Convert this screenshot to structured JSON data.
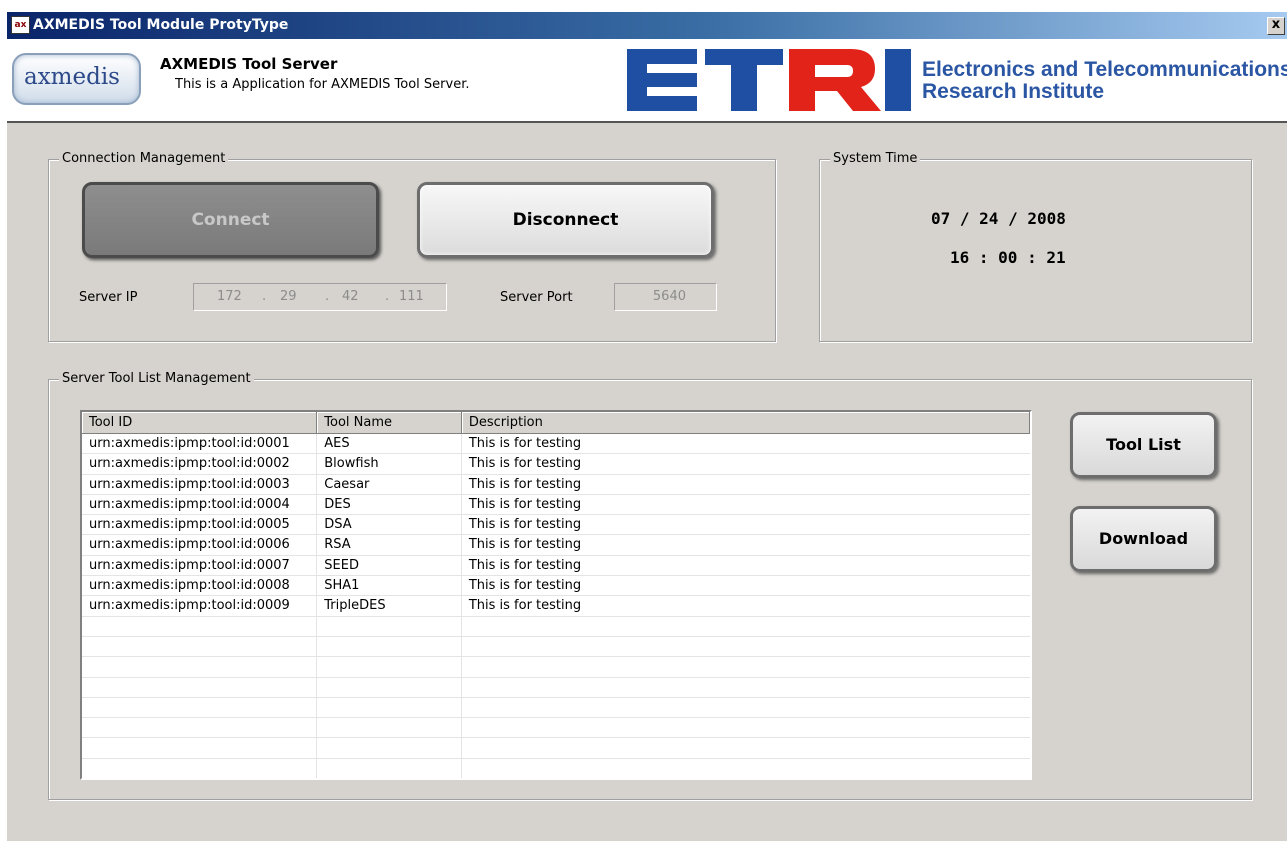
{
  "window": {
    "title": "AXMEDIS Tool Module ProtyType",
    "icon": "app-icon",
    "icon_text": "ax",
    "close_label": "x"
  },
  "banner": {
    "logo_text": "axmedis",
    "title": "AXMEDIS Tool Server",
    "subtitle": "This is a Application for AXMEDIS Tool Server.",
    "etri_logo_text": "ETRI",
    "org_line1": "Electronics and Telecommunications",
    "org_line2": "Research Institute"
  },
  "connection": {
    "group_label": "Connection Management",
    "connect_label": "Connect",
    "disconnect_label": "Disconnect",
    "server_ip_label": "Server IP",
    "ip_octets": [
      "172",
      "29",
      "42",
      "111"
    ],
    "ip_separator": ".",
    "server_port_label": "Server Port",
    "server_port": "5640"
  },
  "system_time": {
    "group_label": "System Time",
    "date": "07 / 24 / 2008",
    "time": "16 : 00 : 21"
  },
  "tool_list": {
    "group_label": "Server Tool List Management",
    "columns": [
      "Tool ID",
      "Tool Name",
      "Description"
    ],
    "rows": [
      [
        "urn:axmedis:ipmp:tool:id:0001",
        "AES",
        "This is for testing"
      ],
      [
        "urn:axmedis:ipmp:tool:id:0002",
        "Blowfish",
        "This is for testing"
      ],
      [
        "urn:axmedis:ipmp:tool:id:0003",
        "Caesar",
        "This is for testing"
      ],
      [
        "urn:axmedis:ipmp:tool:id:0004",
        "DES",
        "This is for testing"
      ],
      [
        "urn:axmedis:ipmp:tool:id:0005",
        "DSA",
        "This is for testing"
      ],
      [
        "urn:axmedis:ipmp:tool:id:0006",
        "RSA",
        "This is for testing"
      ],
      [
        "urn:axmedis:ipmp:tool:id:0007",
        "SEED",
        "This is for testing"
      ],
      [
        "urn:axmedis:ipmp:tool:id:0008",
        "SHA1",
        "This is for testing"
      ],
      [
        "urn:axmedis:ipmp:tool:id:0009",
        "TripleDES",
        "This is for testing"
      ]
    ],
    "tool_list_button": "Tool List",
    "download_button": "Download"
  },
  "colors": {
    "title_bar": "#0a246a",
    "window_bg": "#d6d3ce",
    "etri_blue": "#1f4fa3",
    "etri_red": "#e2231a"
  }
}
